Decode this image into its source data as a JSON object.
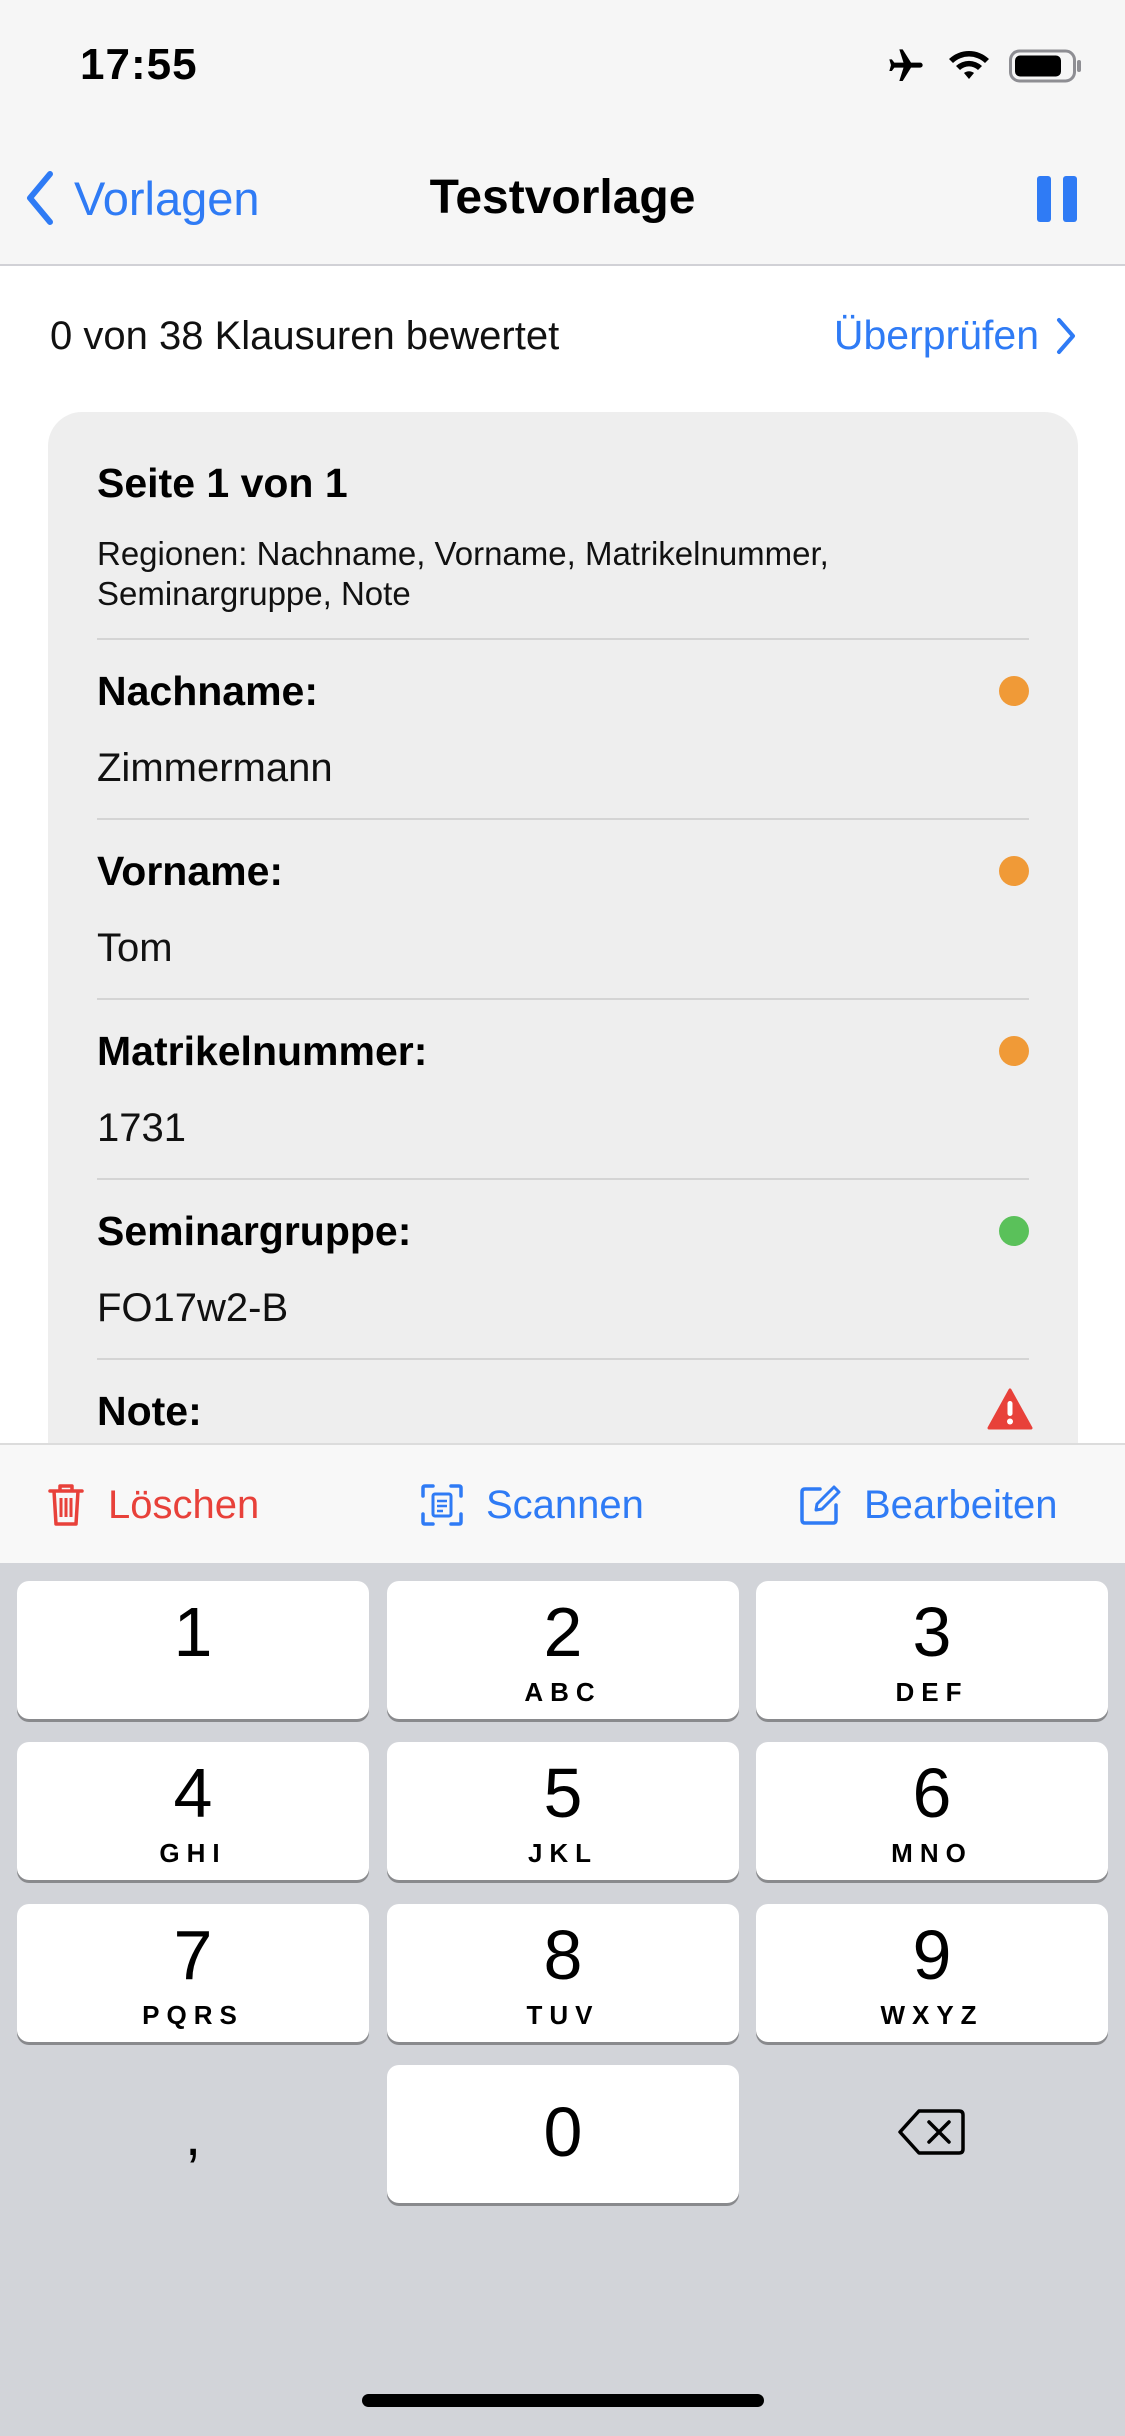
{
  "status_bar": {
    "time": "17:55"
  },
  "nav": {
    "back_label": "Vorlagen",
    "title": "Testvorlage"
  },
  "progress": {
    "text": "0 von 38 Klausuren bewertet",
    "review_label": "Überprüfen"
  },
  "card": {
    "title": "Seite 1 von 1",
    "regions": "Regionen: Nachname, Vorname, Matrikelnummer, Seminargruppe, Note",
    "fields": [
      {
        "label": "Nachname:",
        "value": "Zimmermann",
        "status": "orange",
        "color": "#f09a37"
      },
      {
        "label": "Vorname:",
        "value": "Tom",
        "status": "orange",
        "color": "#f09a37"
      },
      {
        "label": "Matrikelnummer:",
        "value": "1731",
        "status": "orange",
        "color": "#f09a37"
      },
      {
        "label": "Seminargruppe:",
        "value": "FO17w2-B",
        "status": "green",
        "color": "#5ac15a"
      },
      {
        "label": "Note:",
        "value": "",
        "status": "warning",
        "color": "#e8413a"
      }
    ]
  },
  "toolbar": {
    "delete_label": "Löschen",
    "scan_label": "Scannen",
    "edit_label": "Bearbeiten",
    "delete_color": "#e8413a",
    "accent_color": "#2f7bf5"
  },
  "keypad": {
    "keys": [
      {
        "num": "1",
        "letters": ""
      },
      {
        "num": "2",
        "letters": "ABC"
      },
      {
        "num": "3",
        "letters": "DEF"
      },
      {
        "num": "4",
        "letters": "GHI"
      },
      {
        "num": "5",
        "letters": "JKL"
      },
      {
        "num": "6",
        "letters": "MNO"
      },
      {
        "num": "7",
        "letters": "PQRS"
      },
      {
        "num": "8",
        "letters": "TUV"
      },
      {
        "num": "9",
        "letters": "WXYZ"
      },
      {
        "num": "0",
        "letters": ""
      }
    ],
    "comma": ",",
    "delete_icon": "backspace-icon"
  }
}
